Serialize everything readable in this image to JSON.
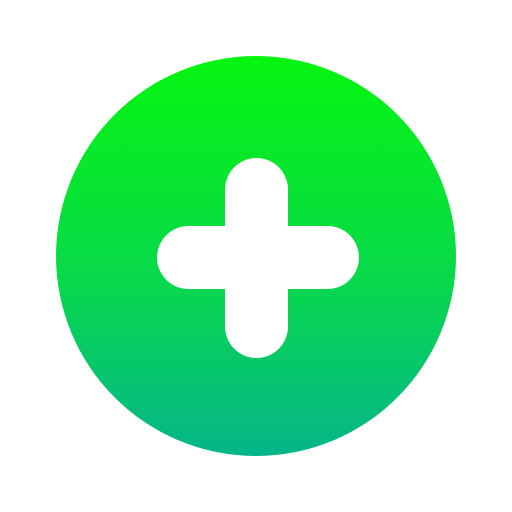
{
  "icon": {
    "name": "plus-icon",
    "colors": {
      "background": "#ffffff",
      "gradient_top": "#06f50f",
      "gradient_mid": "#08d94a",
      "gradient_bottom": "#05b58a",
      "glyph": "#ffffff"
    }
  }
}
